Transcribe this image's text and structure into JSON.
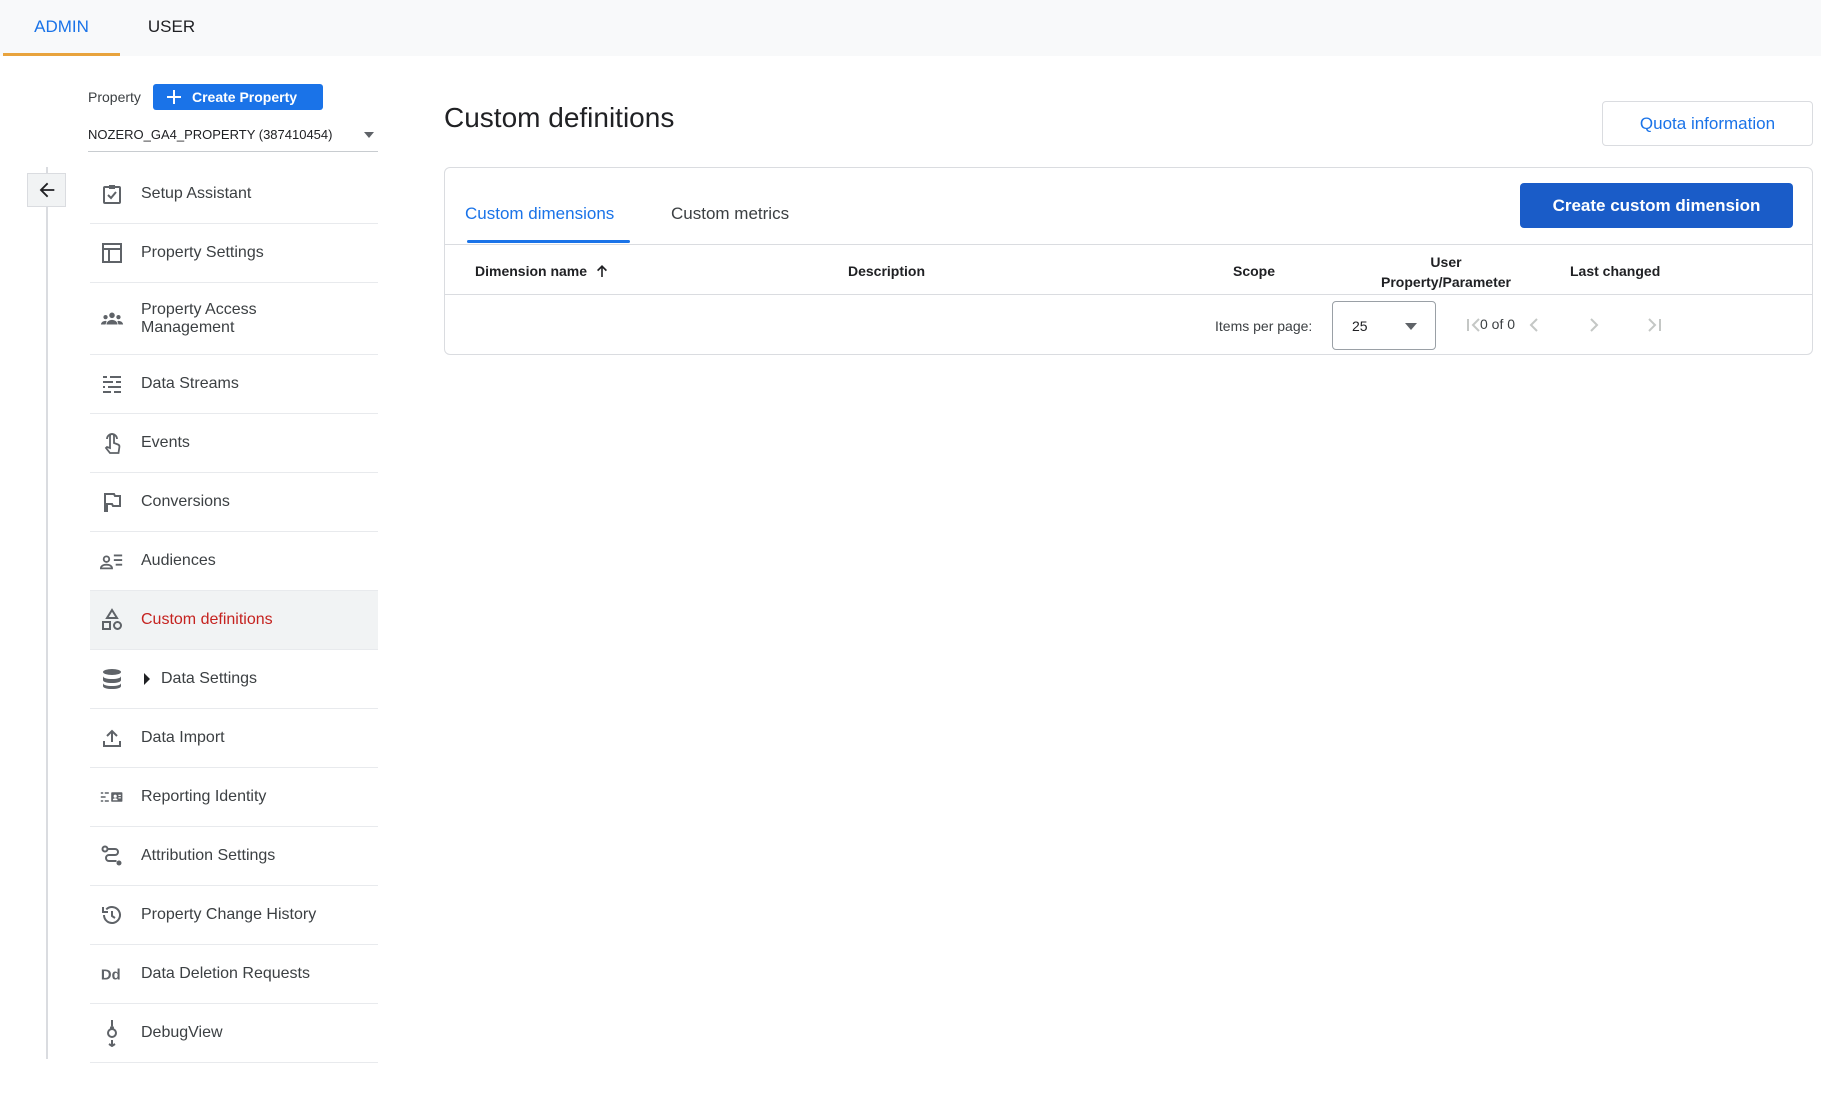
{
  "top_tabs": {
    "admin": "ADMIN",
    "user": "USER"
  },
  "property": {
    "label": "Property",
    "create_label": "Create Property",
    "selected": "NOZERO_GA4_PROPERTY (387410454)"
  },
  "sidebar": {
    "items": [
      {
        "label": "Setup Assistant",
        "icon": "checklist-icon"
      },
      {
        "label": "Property Settings",
        "icon": "layout-icon"
      },
      {
        "label": "Property Access\nManagement",
        "icon": "people-icon"
      },
      {
        "label": "Data Streams",
        "icon": "streams-icon"
      },
      {
        "label": "Events",
        "icon": "touch-icon"
      },
      {
        "label": "Conversions",
        "icon": "flag-icon"
      },
      {
        "label": "Audiences",
        "icon": "audience-icon"
      },
      {
        "label": "Custom definitions",
        "icon": "shapes-icon",
        "active": true
      },
      {
        "label": "Data Settings",
        "icon": "database-icon",
        "expandable": true
      },
      {
        "label": "Data Import",
        "icon": "upload-icon"
      },
      {
        "label": "Reporting Identity",
        "icon": "identity-icon"
      },
      {
        "label": "Attribution Settings",
        "icon": "attribution-icon"
      },
      {
        "label": "Property Change History",
        "icon": "history-icon"
      },
      {
        "label": "Data Deletion Requests",
        "icon": "dd-icon"
      },
      {
        "label": "DebugView",
        "icon": "debug-icon"
      }
    ]
  },
  "main": {
    "title": "Custom definitions",
    "quota_label": "Quota information",
    "tabs": [
      "Custom dimensions",
      "Custom metrics"
    ],
    "create_label": "Create custom dimension",
    "columns": {
      "name": "Dimension name",
      "description": "Description",
      "scope": "Scope",
      "user_param_1": "User",
      "user_param_2": "Property/Parameter",
      "last_changed": "Last changed"
    },
    "pager": {
      "items_per_page_label": "Items per page:",
      "items_per_page": "25",
      "range": "0 of 0"
    }
  },
  "colors": {
    "accent": "#1a73e8",
    "active_nav": "#c5221f",
    "primary_button": "#1a5cc8"
  }
}
